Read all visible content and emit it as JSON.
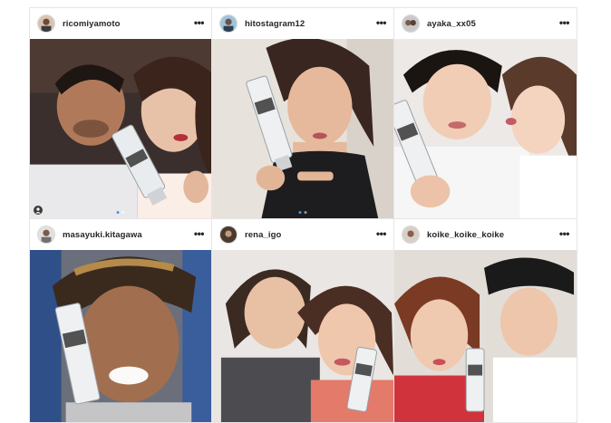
{
  "posts": [
    {
      "username": "ricomiyamoto",
      "more_label": "•••"
    },
    {
      "username": "hitostagram12",
      "more_label": "•••"
    },
    {
      "username": "ayaka_xx05",
      "more_label": "•••"
    },
    {
      "username": "masayuki.kitagawa",
      "more_label": "•••"
    },
    {
      "username": "rena_igo",
      "more_label": "•••"
    },
    {
      "username": "koike_koike_koike",
      "more_label": "•••"
    }
  ],
  "product": {
    "brand_lines": [
      "DE",
      "NIRO"
    ]
  },
  "colors": {
    "accent_dot": "#3897f0",
    "border": "#e6e6e6",
    "text": "#262626"
  }
}
